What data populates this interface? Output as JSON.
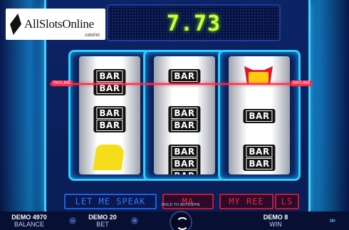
{
  "logo": {
    "text": "AllSlotsOnline",
    "sub": ".casino"
  },
  "win_display": {
    "amount": "7.73"
  },
  "payline": {
    "left_label": "PAYLINE",
    "right_label": "PAYLINE",
    "color": "#ff2a4a"
  },
  "reels": [
    {
      "symbols": [
        "BAR BAR",
        "BAR BAR",
        "yellow-7-blank"
      ]
    },
    {
      "symbols": [
        "BAR",
        "BAR BAR",
        "BAR BAR BAR"
      ]
    },
    {
      "symbols": [
        "red-7",
        "BAR",
        "BAR BAR"
      ]
    }
  ],
  "messages": {
    "strip1": "LET ME SPEAK",
    "strip2": "MA",
    "strip3": "MY REE",
    "strip4": "LS"
  },
  "stats": {
    "balance_value": "DEMO 4970",
    "balance_label": "BALANCE",
    "bet_value": "DEMO 20",
    "bet_label": "BET",
    "win_value": "DEMO 8",
    "win_label": "WIN"
  },
  "controls": {
    "minus": "−",
    "plus": "+",
    "hold_hint": "HOLD TO AUTOSPIN",
    "fast_forward": "»»"
  }
}
